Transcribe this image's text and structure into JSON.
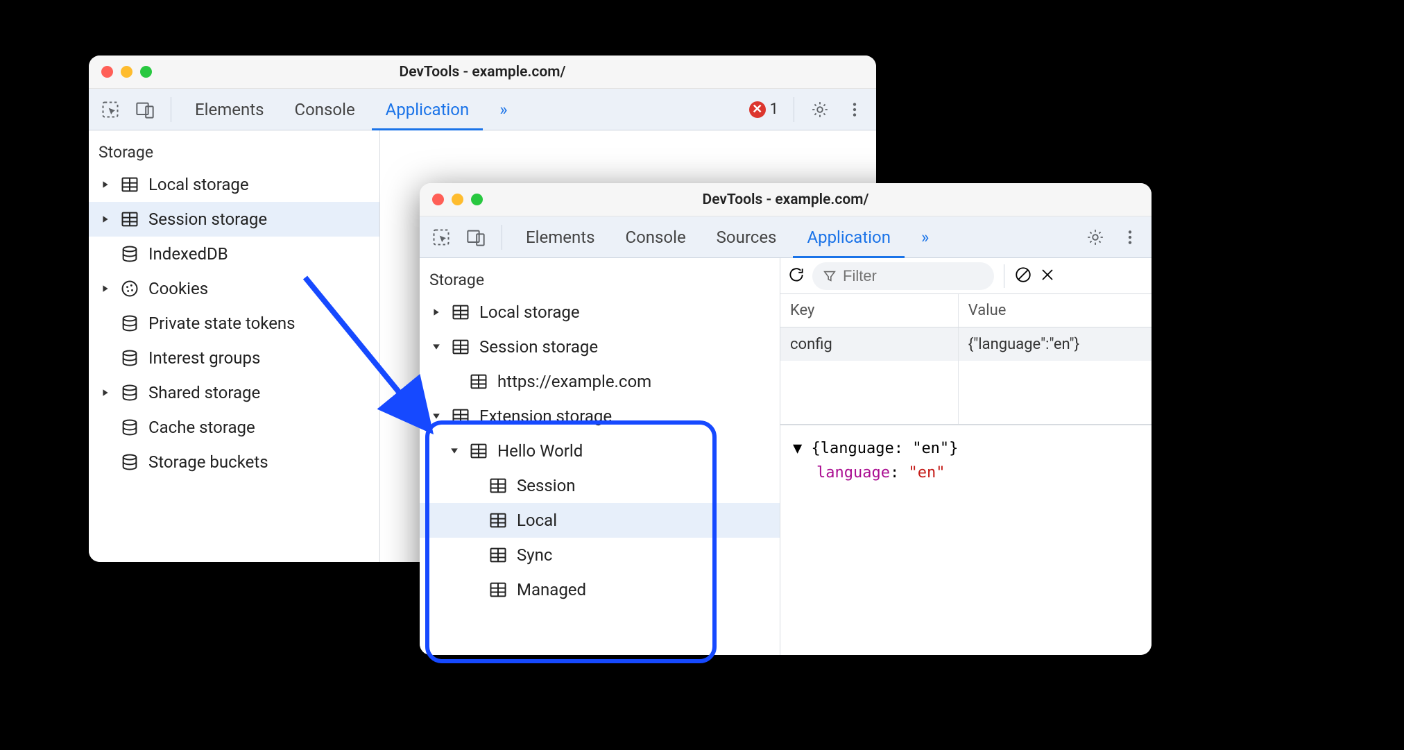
{
  "winA": {
    "title": "DevTools - example.com/",
    "tabs": [
      "Elements",
      "Console",
      "Application"
    ],
    "activeTab": 2,
    "more": "»",
    "errorCount": "1",
    "storageSection": "Storage",
    "items": [
      {
        "label": "Local storage",
        "icon": "table",
        "arrow": "right",
        "depth": 0
      },
      {
        "label": "Session storage",
        "icon": "table",
        "arrow": "right",
        "depth": 0,
        "sel": true
      },
      {
        "label": "IndexedDB",
        "icon": "db",
        "arrow": "",
        "depth": 0
      },
      {
        "label": "Cookies",
        "icon": "cookie",
        "arrow": "right",
        "depth": 0
      },
      {
        "label": "Private state tokens",
        "icon": "db",
        "arrow": "",
        "depth": 0
      },
      {
        "label": "Interest groups",
        "icon": "db",
        "arrow": "",
        "depth": 0
      },
      {
        "label": "Shared storage",
        "icon": "db",
        "arrow": "right",
        "depth": 0
      },
      {
        "label": "Cache storage",
        "icon": "db",
        "arrow": "",
        "depth": 0
      },
      {
        "label": "Storage buckets",
        "icon": "db",
        "arrow": "",
        "depth": 0
      }
    ]
  },
  "winB": {
    "title": "DevTools - example.com/",
    "tabs": [
      "Elements",
      "Console",
      "Sources",
      "Application"
    ],
    "activeTab": 3,
    "more": "»",
    "storageSection": "Storage",
    "items": [
      {
        "label": "Local storage",
        "icon": "table",
        "arrow": "right",
        "depth": 0
      },
      {
        "label": "Session storage",
        "icon": "table",
        "arrow": "down",
        "depth": 0
      },
      {
        "label": "https://example.com",
        "icon": "table",
        "arrow": "",
        "depth": 1
      },
      {
        "label": "Extension storage",
        "icon": "table",
        "arrow": "down",
        "depth": 0
      },
      {
        "label": "Hello World",
        "icon": "table",
        "arrow": "down",
        "depth": 1
      },
      {
        "label": "Session",
        "icon": "table",
        "arrow": "",
        "depth": 2
      },
      {
        "label": "Local",
        "icon": "table",
        "arrow": "",
        "depth": 2,
        "sel": true
      },
      {
        "label": "Sync",
        "icon": "table",
        "arrow": "",
        "depth": 2
      },
      {
        "label": "Managed",
        "icon": "table",
        "arrow": "",
        "depth": 2
      }
    ],
    "filterPlaceholder": "Filter",
    "table": {
      "headers": [
        "Key",
        "Value"
      ],
      "rows": [
        {
          "key": "config",
          "value": "{\"language\":\"en\"}"
        }
      ]
    },
    "json": {
      "summary": "{language: \"en\"}",
      "key": "language",
      "value": "\"en\""
    }
  }
}
